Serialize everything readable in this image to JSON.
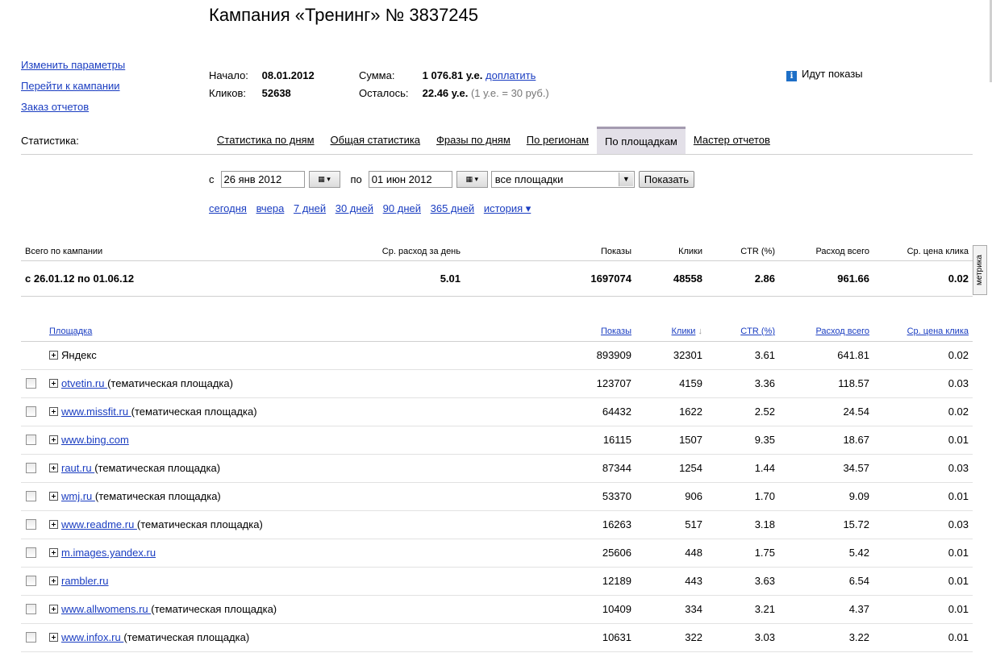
{
  "title": "Кампания «Тренинг» № 3837245",
  "left_links": [
    "Изменить параметры",
    "Перейти к кампании",
    "Заказ отчетов"
  ],
  "info": {
    "start_label": "Начало:",
    "start_value": "08.01.2012",
    "clicks_label": "Кликов:",
    "clicks_value": "52638",
    "sum_label": "Сумма:",
    "sum_value": "1 076.81 у.е.",
    "pay_link": "доплатить",
    "left_label": "Осталось:",
    "left_value": "22.46 у.е.",
    "rate_note": "(1 у.е. = 30 руб.)"
  },
  "status": "Идут показы",
  "stats_label": "Статистика:",
  "tabs": [
    {
      "label": "Статистика по дням",
      "active": false
    },
    {
      "label": "Общая статистика",
      "active": false
    },
    {
      "label": "Фразы по дням",
      "active": false
    },
    {
      "label": "По регионам",
      "active": false
    },
    {
      "label": "По площадкам",
      "active": true
    },
    {
      "label": "Мастер отчетов",
      "active": false
    }
  ],
  "filter": {
    "from_label": "с",
    "from_value": "26 янв 2012",
    "to_label": "по",
    "to_value": "01 июн 2012",
    "select_value": "все площадки",
    "show_button": "Показать"
  },
  "quick_periods": [
    "сегодня",
    "вчера",
    "7 дней",
    "30 дней",
    "90 дней",
    "365 дней",
    "история ▾"
  ],
  "totals": {
    "headers": [
      "Всего по кампании",
      "Ср. расход за день",
      "Показы",
      "Клики",
      "CTR (%)",
      "Расход всего",
      "Ср. цена клика"
    ],
    "row": [
      "с 26.01.12 по 01.06.12",
      "5.01",
      "1697074",
      "48558",
      "2.86",
      "961.66",
      "0.02"
    ]
  },
  "metrika_label": "метрика",
  "placements": {
    "headers": {
      "site": "Площадка",
      "shows": "Показы",
      "clicks": "Клики",
      "sort_mark": "↓",
      "ctr": "CTR (%)",
      "cost": "Расход всего",
      "avg": "Ср. цена клика"
    },
    "rows": [
      {
        "site": "Яндекс",
        "link": false,
        "note": "",
        "checkbox": false,
        "shows": "893909",
        "clicks": "32301",
        "ctr": "3.61",
        "cost": "641.81",
        "avg": "0.02"
      },
      {
        "site": "otvetin.ru ",
        "link": true,
        "note": "(тематическая площадка)",
        "checkbox": true,
        "shows": "123707",
        "clicks": "4159",
        "ctr": "3.36",
        "cost": "118.57",
        "avg": "0.03"
      },
      {
        "site": "www.missfit.ru ",
        "link": true,
        "note": "(тематическая площадка)",
        "checkbox": true,
        "shows": "64432",
        "clicks": "1622",
        "ctr": "2.52",
        "cost": "24.54",
        "avg": "0.02"
      },
      {
        "site": "www.bing.com",
        "link": true,
        "note": "",
        "checkbox": true,
        "shows": "16115",
        "clicks": "1507",
        "ctr": "9.35",
        "cost": "18.67",
        "avg": "0.01"
      },
      {
        "site": "raut.ru ",
        "link": true,
        "note": "(тематическая площадка)",
        "checkbox": true,
        "shows": "87344",
        "clicks": "1254",
        "ctr": "1.44",
        "cost": "34.57",
        "avg": "0.03"
      },
      {
        "site": "wmj.ru ",
        "link": true,
        "note": "(тематическая площадка)",
        "checkbox": true,
        "shows": "53370",
        "clicks": "906",
        "ctr": "1.70",
        "cost": "9.09",
        "avg": "0.01"
      },
      {
        "site": "www.readme.ru ",
        "link": true,
        "note": "(тематическая площадка)",
        "checkbox": true,
        "shows": "16263",
        "clicks": "517",
        "ctr": "3.18",
        "cost": "15.72",
        "avg": "0.03"
      },
      {
        "site": "m.images.yandex.ru",
        "link": true,
        "note": "",
        "checkbox": true,
        "shows": "25606",
        "clicks": "448",
        "ctr": "1.75",
        "cost": "5.42",
        "avg": "0.01"
      },
      {
        "site": "rambler.ru",
        "link": true,
        "note": "",
        "checkbox": true,
        "shows": "12189",
        "clicks": "443",
        "ctr": "3.63",
        "cost": "6.54",
        "avg": "0.01"
      },
      {
        "site": "www.allwomens.ru ",
        "link": true,
        "note": "(тематическая площадка)",
        "checkbox": true,
        "shows": "10409",
        "clicks": "334",
        "ctr": "3.21",
        "cost": "4.37",
        "avg": "0.01"
      },
      {
        "site": "www.infox.ru ",
        "link": true,
        "note": "(тематическая площадка)",
        "checkbox": true,
        "shows": "10631",
        "clicks": "322",
        "ctr": "3.03",
        "cost": "3.22",
        "avg": "0.01"
      }
    ]
  }
}
